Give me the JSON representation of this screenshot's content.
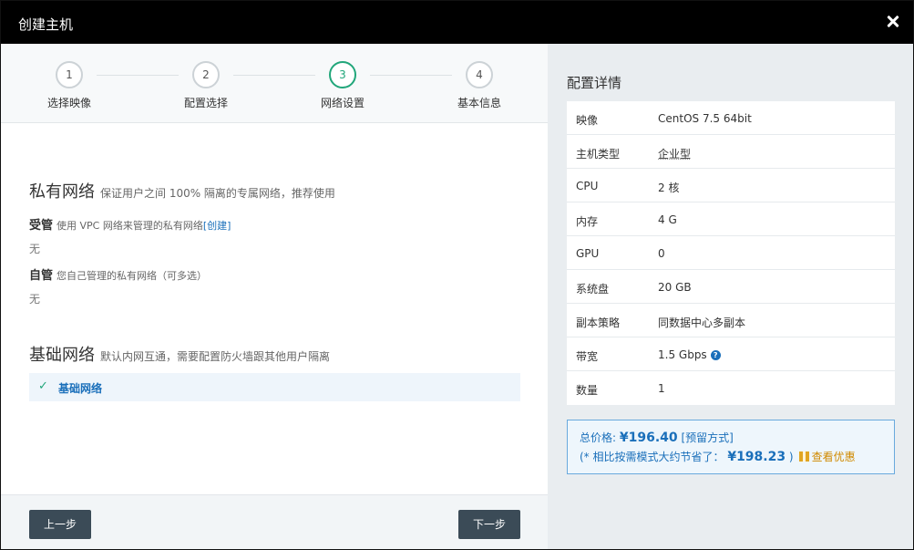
{
  "dialog": {
    "title": "创建主机"
  },
  "steps": [
    {
      "num": "1",
      "label": "选择映像"
    },
    {
      "num": "2",
      "label": "配置选择"
    },
    {
      "num": "3",
      "label": "网络设置"
    },
    {
      "num": "4",
      "label": "基本信息"
    }
  ],
  "private_net": {
    "title": "私有网络",
    "desc": "保证用户之间 100% 隔离的专属网络，推荐使用",
    "managed": {
      "title": "受管",
      "desc": "使用 VPC 网络来管理的私有网络",
      "link": "[创建]",
      "value": "无"
    },
    "self": {
      "title": "自管",
      "desc": "您自己管理的私有网络（可多选）",
      "value": "无"
    }
  },
  "basic_net": {
    "title": "基础网络",
    "desc": "默认内网互通，需要配置防火墙跟其他用户隔离",
    "option": "基础网络",
    "check": "✓"
  },
  "footer": {
    "prev": "上一步",
    "next": "下一步"
  },
  "config": {
    "heading": "配置详情",
    "rows": [
      {
        "k": "映像",
        "v": "CentOS 7.5 64bit"
      },
      {
        "k": "主机类型",
        "v": "企业型"
      },
      {
        "k": "CPU",
        "v": "2 核"
      },
      {
        "k": "内存",
        "v": "4 G"
      },
      {
        "k": "GPU",
        "v": "0"
      },
      {
        "k": "系统盘",
        "v": "20 GB"
      },
      {
        "k": "副本策略",
        "v": "同数据中心多副本"
      },
      {
        "k": "带宽",
        "v": "1.5 Gbps"
      },
      {
        "k": "数量",
        "v": "1"
      }
    ],
    "help_glyph": "?"
  },
  "price": {
    "total_label": "总价格:",
    "total_amount": "¥196.40",
    "mode": "[预留方式]",
    "save_prefix": "(* 相比按需模式大约节省了：",
    "save_amount": "¥198.23",
    "save_suffix": ")",
    "deal_link": "查看优惠"
  },
  "colors": {
    "accent": "#1a6fba",
    "step_active": "#21a67a",
    "titlebar": "#000000"
  }
}
